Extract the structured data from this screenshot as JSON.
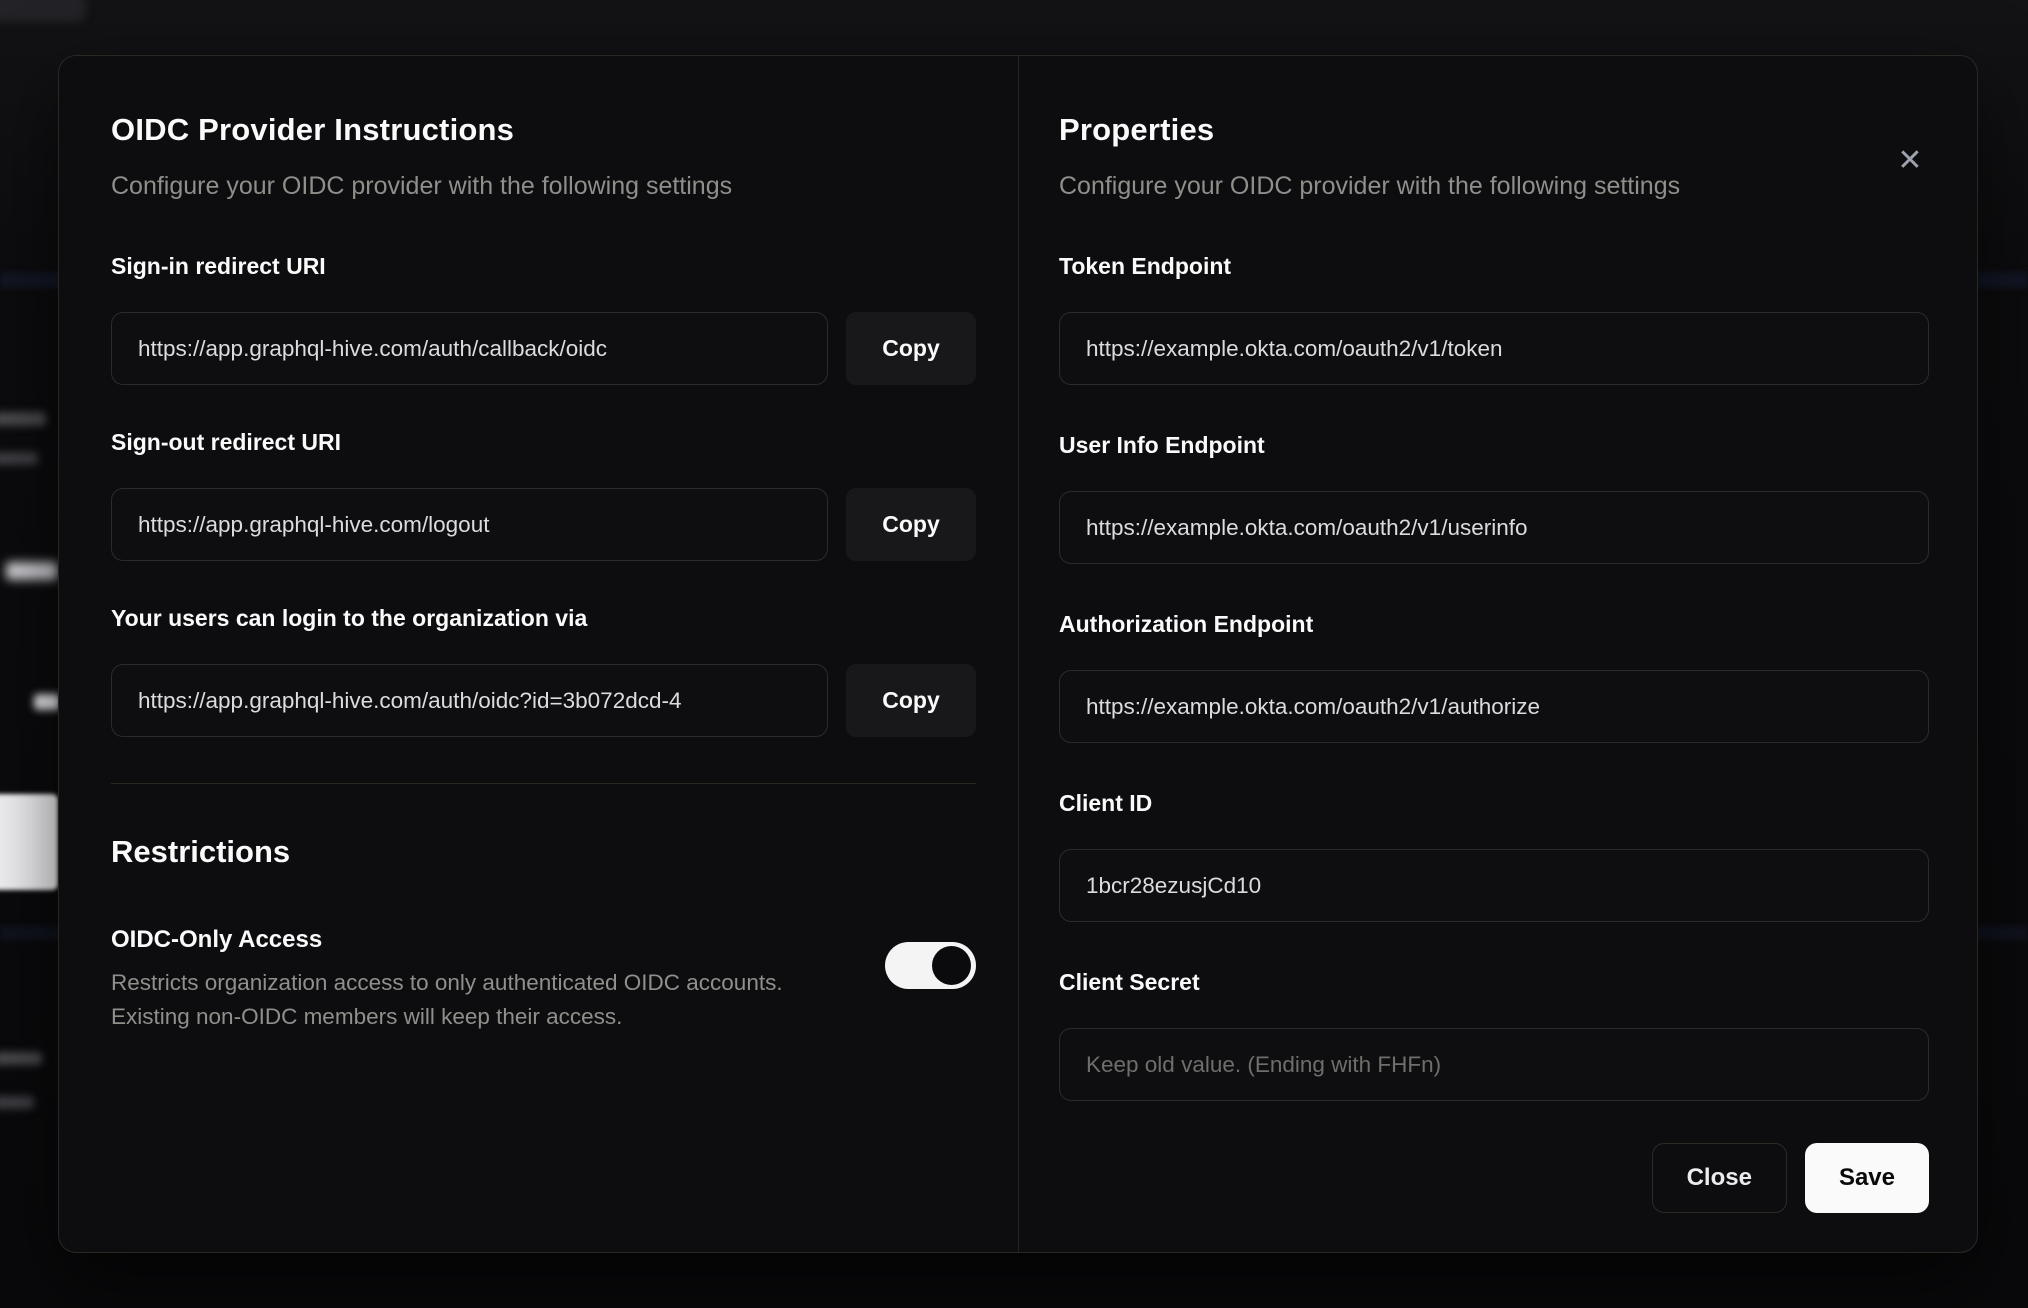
{
  "modal": {
    "close_icon": "✕",
    "left": {
      "title": "OIDC Provider Instructions",
      "subtitle": "Configure your OIDC provider with the following settings",
      "fields": [
        {
          "label": "Sign-in redirect URI",
          "value": "https://app.graphql-hive.com/auth/callback/oidc",
          "copy_label": "Copy"
        },
        {
          "label": "Sign-out redirect URI",
          "value": "https://app.graphql-hive.com/logout",
          "copy_label": "Copy"
        },
        {
          "label": "Your users can login to the organization via",
          "value": "https://app.graphql-hive.com/auth/oidc?id=3b072dcd-4",
          "copy_label": "Copy"
        }
      ],
      "restrictions": {
        "title": "Restrictions",
        "toggle_label": "OIDC-Only Access",
        "toggle_description_line1": "Restricts organization access to only authenticated OIDC accounts.",
        "toggle_description_line2": "Existing non-OIDC members will keep their access.",
        "toggle_state": "on"
      }
    },
    "right": {
      "title": "Properties",
      "subtitle": "Configure your OIDC provider with the following settings",
      "fields": [
        {
          "label": "Token Endpoint",
          "value": "https://example.okta.com/oauth2/v1/token"
        },
        {
          "label": "User Info Endpoint",
          "value": "https://example.okta.com/oauth2/v1/userinfo"
        },
        {
          "label": "Authorization Endpoint",
          "value": "https://example.okta.com/oauth2/v1/authorize"
        },
        {
          "label": "Client ID",
          "value": "1bcr28ezusjCd10"
        },
        {
          "label": "Client Secret",
          "value": "",
          "placeholder": "Keep old value. (Ending with FHFn)"
        }
      ],
      "buttons": {
        "close": "Close",
        "save": "Save"
      }
    }
  },
  "colors": {
    "modal_background": "#0d0d10",
    "accent_button": "#fafafa",
    "toggle_on_track": "#f4f4f5",
    "input_border": "#2d2b28",
    "muted_text": "#908e8a"
  }
}
